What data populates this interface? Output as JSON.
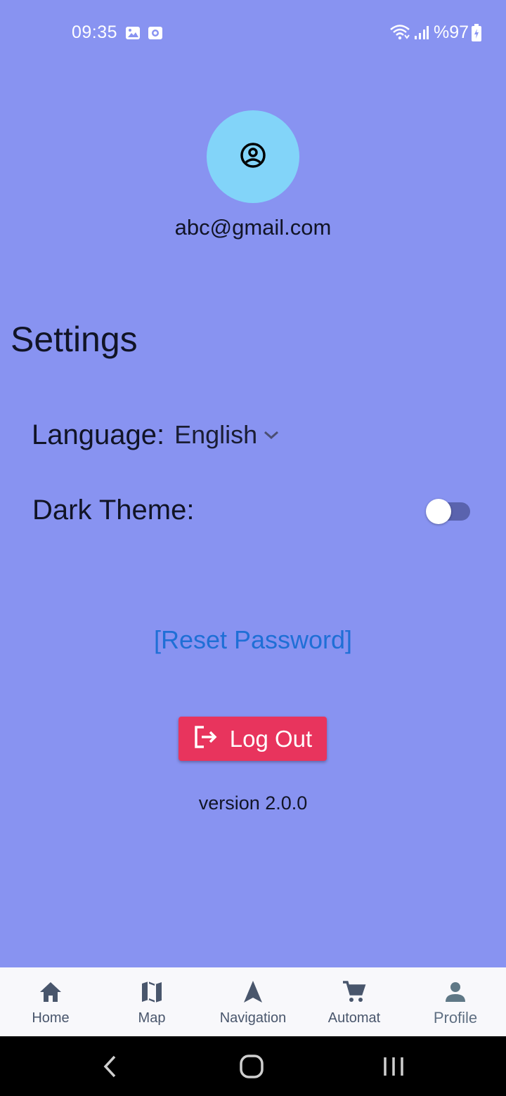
{
  "status_bar": {
    "time": "09:35",
    "battery": "%97",
    "icons": [
      "gallery-icon",
      "screen-record-icon",
      "wifi-icon",
      "signal-icon",
      "battery-charging-icon"
    ]
  },
  "profile": {
    "avatar_icon": "account-circle-icon",
    "email": "abc@gmail.com"
  },
  "settings": {
    "title": "Settings",
    "language_label": "Language:",
    "language_value": "English",
    "dark_theme_label": "Dark Theme:",
    "dark_theme_enabled": false
  },
  "actions": {
    "reset_password": "[Reset Password]",
    "logout": "Log Out",
    "version": "version 2.0.0"
  },
  "bottom_nav": {
    "items": [
      {
        "label": "Home",
        "icon": "home-icon"
      },
      {
        "label": "Map",
        "icon": "map-icon"
      },
      {
        "label": "Navigation",
        "icon": "navigation-icon"
      },
      {
        "label": "Automat",
        "icon": "cart-icon"
      },
      {
        "label": "Profile",
        "icon": "person-icon",
        "active": true
      }
    ]
  },
  "colors": {
    "background": "#8893f1",
    "avatar": "#82d4f9",
    "logout": "#e8345d",
    "link": "#1f6fd6",
    "nav_background": "#f8f8fb"
  }
}
